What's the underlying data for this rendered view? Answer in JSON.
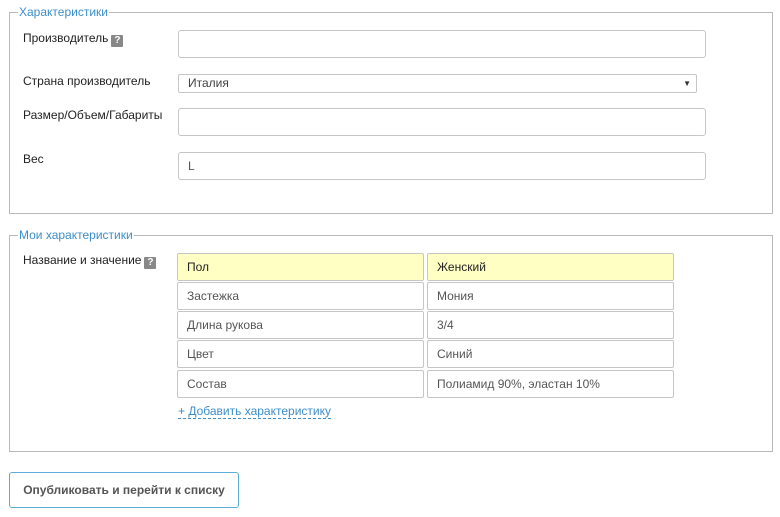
{
  "characteristics": {
    "legend": "Характеристики",
    "manufacturer": {
      "label": "Производитель",
      "value": ""
    },
    "country": {
      "label": "Страна производитель",
      "selected": "Италия"
    },
    "size": {
      "label": "Размер/Объем/Габариты",
      "value": ""
    },
    "weight": {
      "label": "Вес",
      "value": "L"
    }
  },
  "my_characteristics": {
    "legend": "Мои характеристики",
    "label": "Название и значение",
    "rows": [
      {
        "name": "Пол",
        "value": "Женский"
      },
      {
        "name": "Застежка",
        "value": "Мония"
      },
      {
        "name": "Длина рукова",
        "value": "3/4"
      },
      {
        "name": "Цвет",
        "value": "Синий"
      },
      {
        "name": "Состав",
        "value": "Полиамид 90%, эластан 10%"
      }
    ],
    "add_link": "+ Добавить характеристику"
  },
  "help_icon_text": "?",
  "select_arrow": "▼",
  "publish_button": "Опубликовать и перейти к списку"
}
